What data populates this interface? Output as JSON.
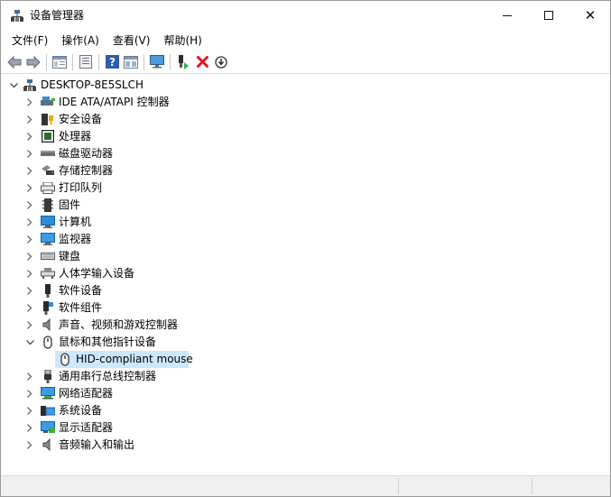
{
  "window": {
    "title": "设备管理器",
    "controls": {
      "minimize": "–",
      "maximize": "□",
      "close": "✕"
    }
  },
  "menu": [
    "文件(F)",
    "操作(A)",
    "查看(V)",
    "帮助(H)"
  ],
  "toolbar": [
    {
      "name": "back-arrow-icon"
    },
    {
      "name": "forward-arrow-icon"
    },
    {
      "name": "separator"
    },
    {
      "name": "properties-view-icon"
    },
    {
      "name": "separator"
    },
    {
      "name": "scan-hardware-icon"
    },
    {
      "name": "separator"
    },
    {
      "name": "help-icon"
    },
    {
      "name": "device-list-icon"
    },
    {
      "name": "separator"
    },
    {
      "name": "monitor-scan-icon"
    },
    {
      "name": "separator"
    },
    {
      "name": "update-driver-icon"
    },
    {
      "name": "uninstall-x-icon"
    },
    {
      "name": "download-circle-icon"
    }
  ],
  "tree": {
    "root": {
      "label": "DESKTOP-8E5SLCH",
      "expanded": true,
      "icon": "computer-root-icon"
    },
    "items": [
      {
        "label": "IDE ATA/ATAPI 控制器",
        "icon": "ide-controller-icon",
        "expanded": false
      },
      {
        "label": "安全设备",
        "icon": "security-device-icon",
        "expanded": false
      },
      {
        "label": "处理器",
        "icon": "processor-icon",
        "expanded": false
      },
      {
        "label": "磁盘驱动器",
        "icon": "disk-drive-icon",
        "expanded": false
      },
      {
        "label": "存储控制器",
        "icon": "storage-controller-icon",
        "expanded": false
      },
      {
        "label": "打印队列",
        "icon": "printer-icon",
        "expanded": false
      },
      {
        "label": "固件",
        "icon": "firmware-icon",
        "expanded": false
      },
      {
        "label": "计算机",
        "icon": "computer-icon",
        "expanded": false
      },
      {
        "label": "监视器",
        "icon": "monitor-icon",
        "expanded": false
      },
      {
        "label": "键盘",
        "icon": "keyboard-icon",
        "expanded": false
      },
      {
        "label": "人体学输入设备",
        "icon": "hid-icon",
        "expanded": false
      },
      {
        "label": "软件设备",
        "icon": "software-device-icon",
        "expanded": false
      },
      {
        "label": "软件组件",
        "icon": "software-component-icon",
        "expanded": false
      },
      {
        "label": "声音、视频和游戏控制器",
        "icon": "sound-icon",
        "expanded": false
      },
      {
        "label": "鼠标和其他指针设备",
        "icon": "mouse-icon",
        "expanded": true,
        "children": [
          {
            "label": "HID-compliant mouse",
            "icon": "mouse-icon",
            "selected": true
          }
        ]
      },
      {
        "label": "通用串行总线控制器",
        "icon": "usb-icon",
        "expanded": false
      },
      {
        "label": "网络适配器",
        "icon": "network-adapter-icon",
        "expanded": false
      },
      {
        "label": "系统设备",
        "icon": "system-device-icon",
        "expanded": false
      },
      {
        "label": "显示适配器",
        "icon": "display-adapter-icon",
        "expanded": false
      },
      {
        "label": "音频输入和输出",
        "icon": "audio-io-icon",
        "expanded": false
      }
    ]
  },
  "colors": {
    "selection": "#cce8ff",
    "accent": "#2e8ed8",
    "uninstall": "#e81123"
  }
}
